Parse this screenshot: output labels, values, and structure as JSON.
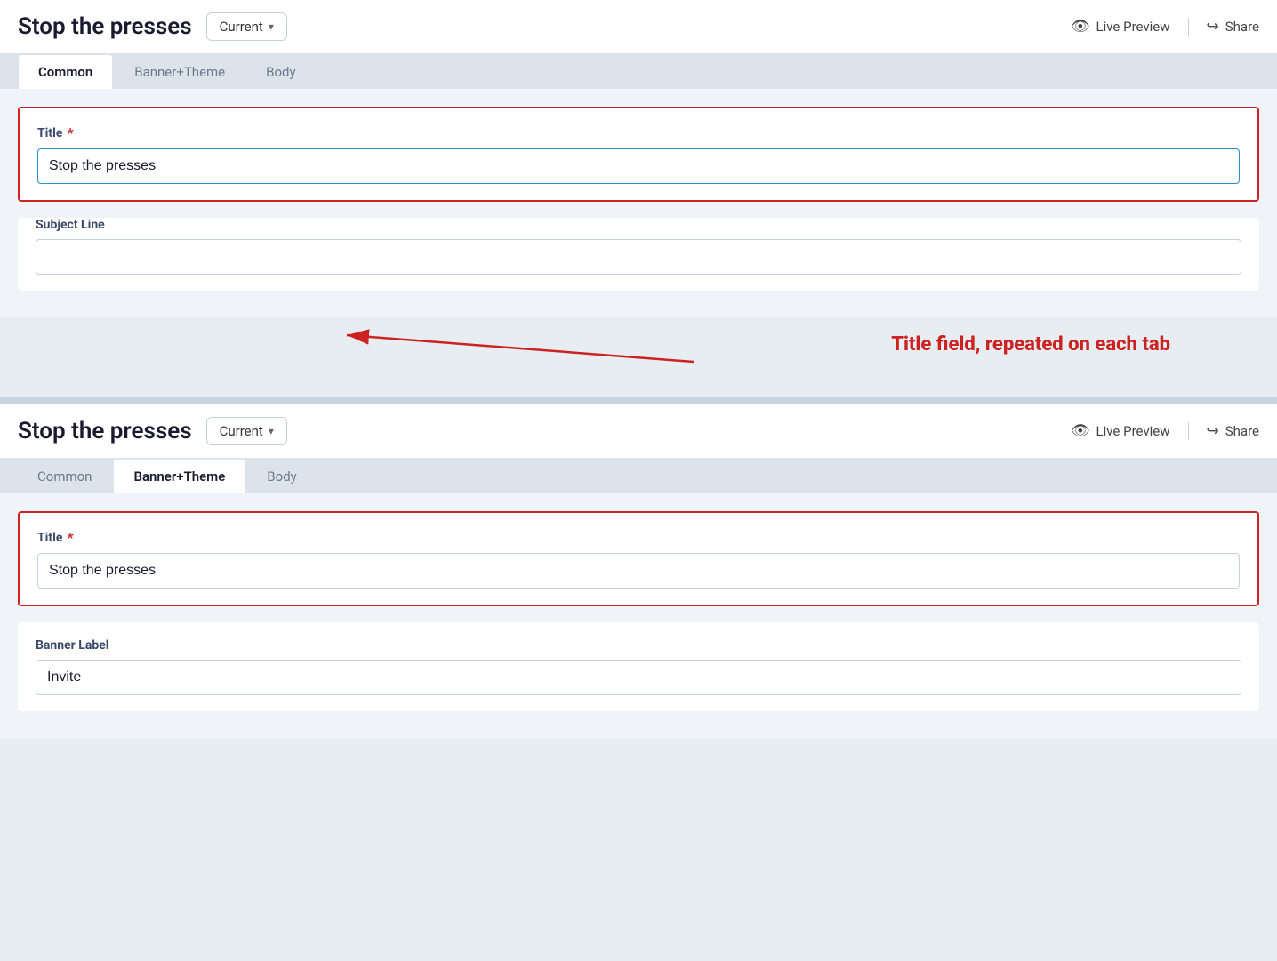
{
  "app": {
    "title": "Stop the presses",
    "version_label": "Current",
    "version_chevron": "▾",
    "live_preview_label": "Live Preview",
    "share_label": "Share"
  },
  "panel1": {
    "tabs": [
      {
        "id": "common",
        "label": "Common",
        "active": true
      },
      {
        "id": "banner-theme",
        "label": "Banner+Theme",
        "active": false
      },
      {
        "id": "body",
        "label": "Body",
        "active": false
      }
    ],
    "title_field": {
      "label": "Title",
      "required": true,
      "value": "Stop the presses",
      "focused": true
    },
    "subject_field": {
      "label": "Subject Line",
      "required": false,
      "value": "",
      "placeholder": ""
    }
  },
  "annotation": {
    "text": "Title field, repeated on each tab"
  },
  "panel2": {
    "tabs": [
      {
        "id": "common",
        "label": "Common",
        "active": false
      },
      {
        "id": "banner-theme",
        "label": "Banner+Theme",
        "active": true
      },
      {
        "id": "body",
        "label": "Body",
        "active": false
      }
    ],
    "title_field": {
      "label": "Title",
      "required": true,
      "value": "Stop the presses"
    },
    "banner_field": {
      "label": "Banner Label",
      "value": "Invite"
    }
  },
  "icons": {
    "eye": "👁",
    "share": "↪"
  }
}
